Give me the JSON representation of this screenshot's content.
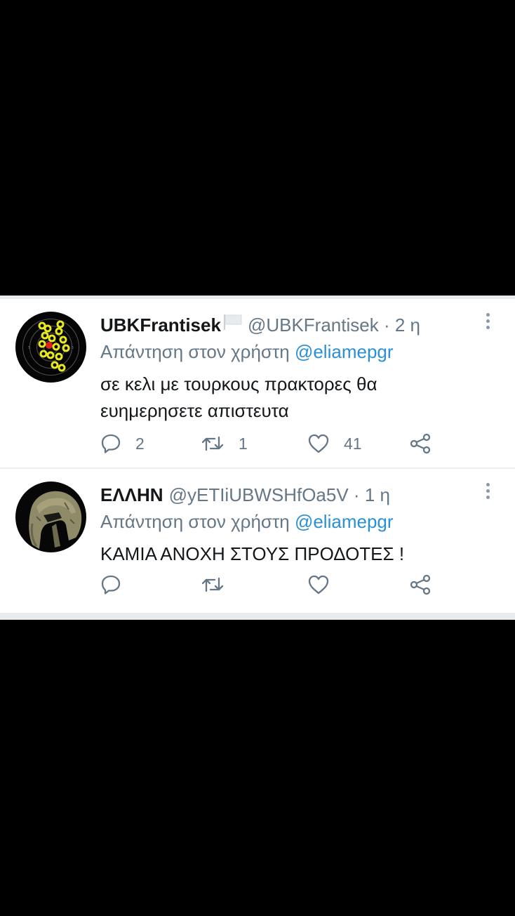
{
  "tweets": [
    {
      "display_name": "UBKFrantisek",
      "flag_icon": "white-flag-icon",
      "handle": "@UBKFrantisek",
      "separator": "·",
      "age": "2 η",
      "reply_prefix": "Απάντηση στον χρήστη",
      "reply_to": "@eliamepgr",
      "text_line1": "σε κελι με τουρκους πρακτορες θα",
      "text_line2": "ευημερησετε απιστευτα",
      "replies": "2",
      "retweets": "1",
      "likes": "41",
      "avatar_icon": "shooting-target-avatar"
    },
    {
      "display_name": "ΕΛΛΗΝ",
      "handle": "@yETIiUBWSHfOa5V",
      "separator": "·",
      "age": "1 η",
      "reply_prefix": "Απάντηση στον χρήστη",
      "reply_to": "@eliamepgr",
      "text_line1": "ΚΑΜΙΑ ΑΝΟΧΗ ΣΤΟΥΣ ΠΡΟΔΟΤΕΣ !",
      "replies": "",
      "retweets": "",
      "likes": "",
      "avatar_icon": "spartan-helmet-avatar"
    }
  ],
  "colors": {
    "background": "#000000",
    "card": "#ffffff",
    "secondary_text": "#657786",
    "mention": "#2b8fd6",
    "primary_text": "#14171a"
  }
}
